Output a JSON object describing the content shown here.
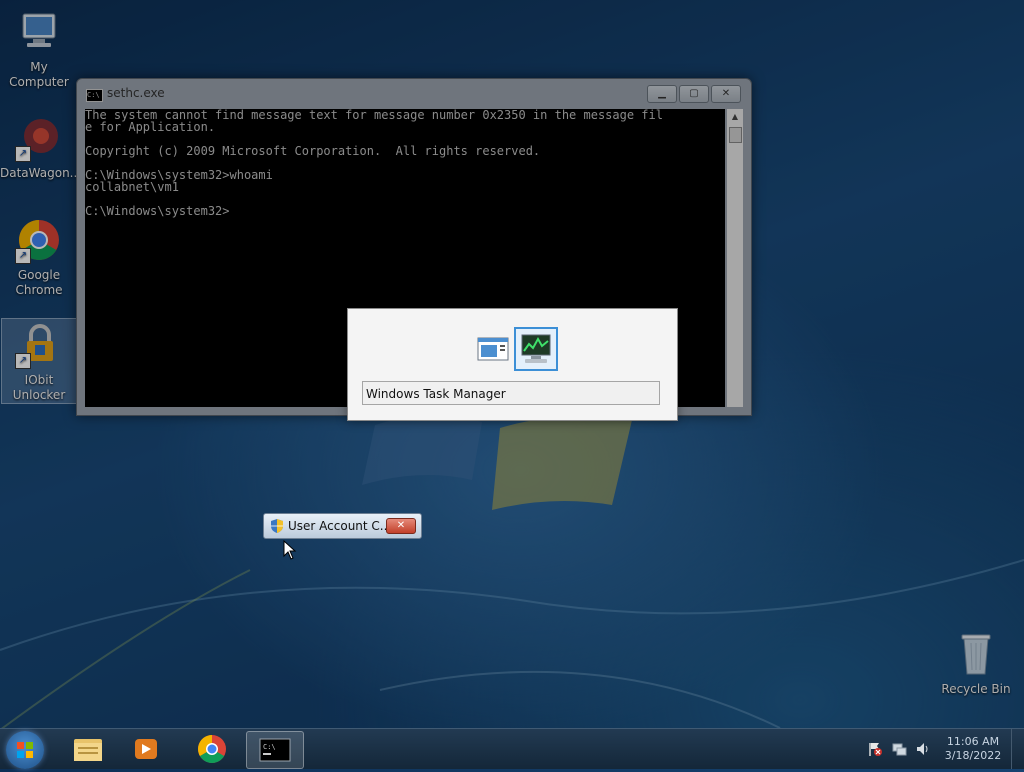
{
  "desktop": {
    "icons": [
      {
        "label": "My Computer"
      },
      {
        "label": "DataWagon..."
      },
      {
        "label": "Google Chrome"
      },
      {
        "label": "IObit Unlocker"
      },
      {
        "label": "Recycle Bin"
      }
    ]
  },
  "cmd_window": {
    "title": "sethc.exe",
    "controls": {
      "minimize": "▁",
      "maximize": "▢",
      "close": "✕"
    },
    "lines": [
      "The system cannot find message text for message number 0x2350 in the message fil",
      "e for Application.",
      "",
      "Copyright (c) 2009 Microsoft Corporation.  All rights reserved.",
      "",
      "C:\\Windows\\system32>whoami",
      "collabnet\\vm1",
      "",
      "C:\\Windows\\system32>"
    ]
  },
  "alt_tab": {
    "items": [
      {
        "icon": "window-list-icon"
      },
      {
        "icon": "task-manager-icon"
      }
    ],
    "selected_label": "Windows Task Manager"
  },
  "uac_chip": {
    "label": "User Account C...",
    "close": "✕"
  },
  "taskbar": {
    "clock": {
      "time": "11:06 AM",
      "date": "3/18/2022"
    },
    "colors": {
      "accent": "#3c8fd6",
      "uac_close": "#c2402a"
    }
  }
}
